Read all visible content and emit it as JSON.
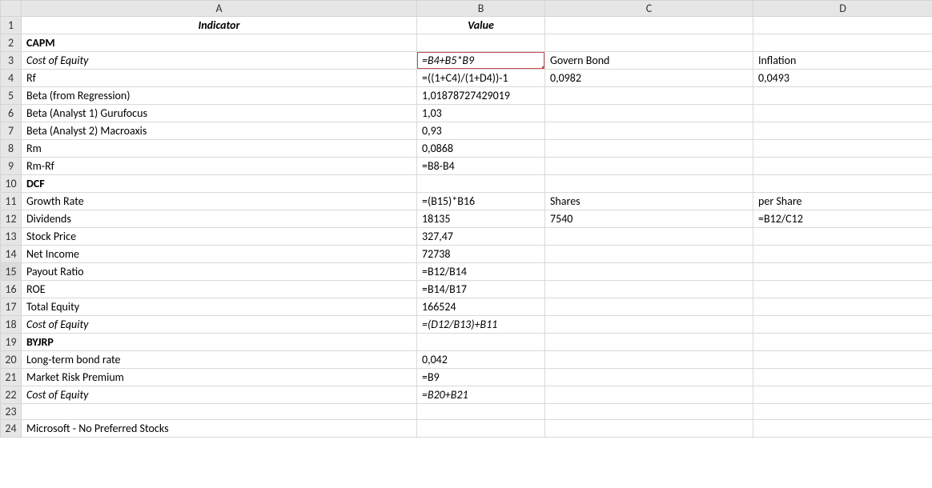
{
  "columns": {
    "A": "A",
    "B": "B",
    "C": "C",
    "D": "D"
  },
  "rownums": [
    "1",
    "2",
    "3",
    "4",
    "5",
    "6",
    "7",
    "8",
    "9",
    "10",
    "11",
    "12",
    "13",
    "14",
    "15",
    "16",
    "17",
    "18",
    "19",
    "20",
    "21",
    "22",
    "23",
    "24"
  ],
  "rows": [
    {
      "A": "Indicator",
      "B": "Value",
      "C": "",
      "D": "",
      "A_cls": "header-italic-bold",
      "B_cls": "header-italic-bold"
    },
    {
      "A": "CAPM",
      "B": "",
      "C": "",
      "D": "",
      "A_cls": "bold"
    },
    {
      "A": "Cost of Equity",
      "B": "=B4+B5*B9",
      "C": "Govern Bond",
      "D": "Inflation",
      "A_cls": "italic",
      "B_cls": "italic active"
    },
    {
      "A": "Rf",
      "B": "=((1+C4)/(1+D4))-1",
      "C": "0,0982",
      "D": "0,0493"
    },
    {
      "A": "Beta (from Regression)",
      "B": "1,01878727429019",
      "C": "",
      "D": ""
    },
    {
      "A": "Beta (Analyst 1) Gurufocus",
      "B": "1,03",
      "C": "",
      "D": ""
    },
    {
      "A": "Beta (Analyst 2) Macroaxis",
      "B": "0,93",
      "C": "",
      "D": ""
    },
    {
      "A": "Rm",
      "B": "0,0868",
      "C": "",
      "D": ""
    },
    {
      "A": "Rm-Rf",
      "B": "=B8-B4",
      "C": "",
      "D": ""
    },
    {
      "A": "DCF",
      "B": "",
      "C": "",
      "D": "",
      "A_cls": "bold"
    },
    {
      "A": "Growth Rate",
      "B": "=(B15)*B16",
      "C": "Shares",
      "D": "per Share"
    },
    {
      "A": "Dividends",
      "B": "18135",
      "C": "7540",
      "D": "=B12/C12"
    },
    {
      "A": "Stock Price",
      "B": "327,47",
      "C": "",
      "D": ""
    },
    {
      "A": "Net Income",
      "B": "72738",
      "C": "",
      "D": ""
    },
    {
      "A": "Payout Ratio",
      "B": "=B12/B14",
      "C": "",
      "D": ""
    },
    {
      "A": "ROE",
      "B": "=B14/B17",
      "C": "",
      "D": ""
    },
    {
      "A": "Total Equity",
      "B": "166524",
      "C": "",
      "D": ""
    },
    {
      "A": "Cost of Equity",
      "B": "=(D12/B13)+B11",
      "C": "",
      "D": "",
      "A_cls": "italic",
      "B_cls": "italic"
    },
    {
      "A": "BYJRP",
      "B": "",
      "C": "",
      "D": "",
      "A_cls": "bold"
    },
    {
      "A": "Long-term bond rate",
      "B": "0,042",
      "C": "",
      "D": ""
    },
    {
      "A": "Market Risk Premium",
      "B": "=B9",
      "C": "",
      "D": ""
    },
    {
      "A": "Cost of Equity",
      "B": "=B20+B21",
      "C": "",
      "D": "",
      "A_cls": "italic",
      "B_cls": "italic"
    },
    {
      "A": "",
      "B": "",
      "C": "",
      "D": ""
    },
    {
      "A": "Microsoft - No Preferred Stocks",
      "B": "",
      "C": "",
      "D": ""
    }
  ]
}
